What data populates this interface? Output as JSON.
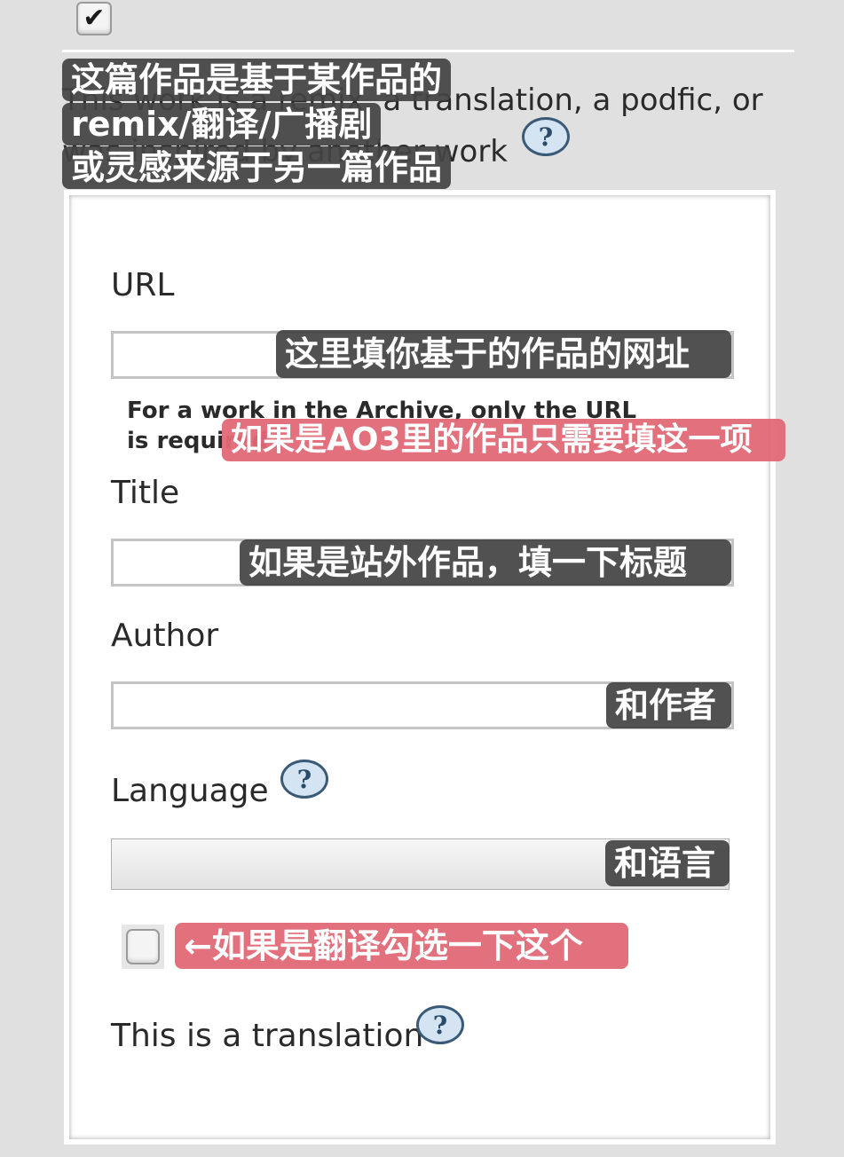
{
  "top_checkbox": {
    "checked": true,
    "glyph": "✔"
  },
  "remix_checkbox_label": "This work is a remix, a translation, a podfic, or was inspired by another work",
  "help_glyph": "?",
  "form": {
    "url_label": "URL",
    "url_value": "",
    "url_note": "For a work in the Archive, only the URL is required.",
    "title_label": "Title",
    "title_value": "",
    "author_label": "Author",
    "author_value": "",
    "language_label": "Language",
    "language_selected": "",
    "translation_label": "This is a translation",
    "translation_checked": false
  },
  "annotations": {
    "remix_line1": "这篇作品是基于某作品的",
    "remix_line2": "remix/翻译/广播剧",
    "remix_line3": "或灵感来源于另一篇作品",
    "url": "这里填你基于的作品的网址",
    "url_note": "如果是AO3里的作品只需要填这一项",
    "title": "如果是站外作品，填一下标题",
    "author": "和作者",
    "language": "和语言",
    "translation": "←如果是翻译勾选一下这个"
  },
  "colors": {
    "tag_dark": "#444444",
    "tag_pink": "#e06876",
    "help_bg": "#d4e4f2",
    "help_border": "#3a5a78"
  }
}
